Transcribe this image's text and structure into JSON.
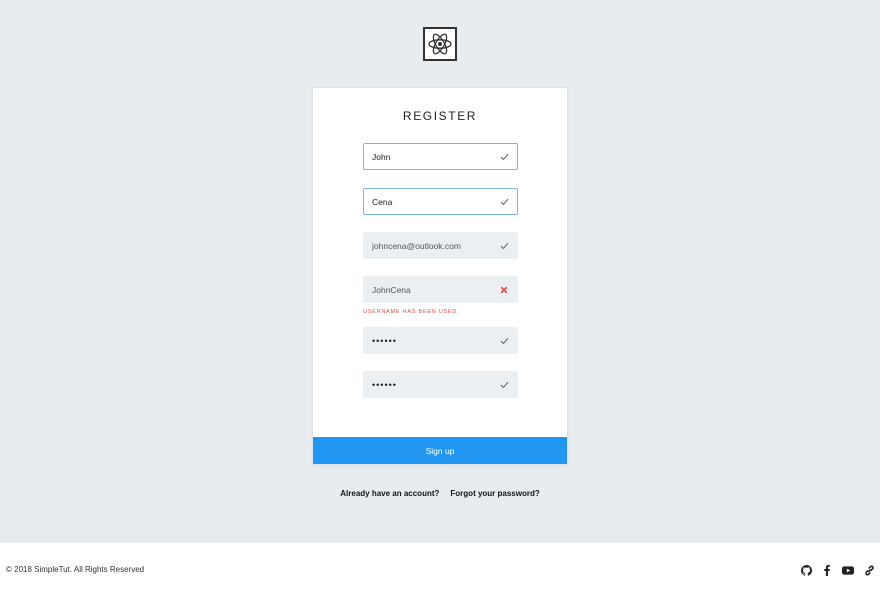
{
  "logo": {
    "icon": "react-atom-icon"
  },
  "form": {
    "title": "REGISTER",
    "fields": [
      {
        "value": "John",
        "status": "valid"
      },
      {
        "value": "Cena",
        "status": "valid"
      },
      {
        "value": "johncena@outlook.com",
        "status": "valid"
      },
      {
        "value": "JohnCena",
        "status": "invalid"
      },
      {
        "value": "••••••",
        "status": "valid"
      },
      {
        "value": "••••••",
        "status": "valid"
      }
    ],
    "username_error": "Username has been used.",
    "submit_label": "Sign up"
  },
  "links": {
    "have_account": "Already have an account?",
    "forgot_password": "Forgot your password?"
  },
  "footer": {
    "copyright": "© 2018 SimpleTut. All Rights Reserved",
    "social_icons": [
      "github-icon",
      "facebook-icon",
      "youtube-icon",
      "link-icon"
    ]
  },
  "colors": {
    "primary": "#2196f3",
    "error": "#e0524f",
    "active_border": "#7fb3e0",
    "background": "#e9ecef"
  }
}
